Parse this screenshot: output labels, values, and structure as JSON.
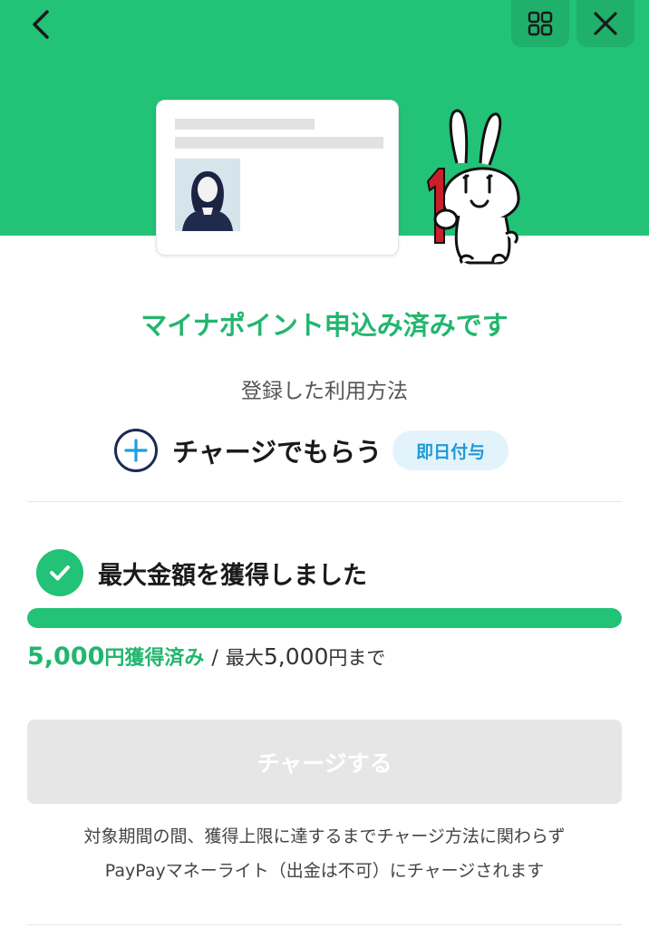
{
  "header": {
    "back_icon": "chevron-left-icon",
    "apps_icon": "grid-icon",
    "close_icon": "close-icon",
    "background_color": "#22c277"
  },
  "hero": {
    "card_icon": "my-number-card-illustration",
    "mascot_icon": "mynaportal-rabbit-mascot"
  },
  "title": "マイナポイント申込み済みです",
  "method": {
    "label": "登録した利用方法",
    "icon": "plus-circle-icon",
    "name": "チャージでもらう",
    "badge": "即日付与"
  },
  "status": {
    "icon": "check-circle-icon",
    "text": "最大金額を獲得しました",
    "progress": 1.0,
    "earned_amount": "5,000",
    "earned_suffix": "円獲得済み",
    "separator": "/",
    "max_prefix": "最大",
    "max_amount": "5,000",
    "max_suffix": "円まで"
  },
  "charge_button": {
    "label": "チャージする",
    "disabled": true
  },
  "note": {
    "line1": "対象期間の間、獲得上限に達するまでチャージ方法に関わらず",
    "line2": "PayPayマネーライト（出金は不可）にチャージされます"
  },
  "colors": {
    "accent": "#22c277",
    "accent_text": "#22b66e",
    "badge_bg": "#e3f3fb",
    "badge_text": "#1f9ad6",
    "disabled_button": "#e6e6e6"
  }
}
